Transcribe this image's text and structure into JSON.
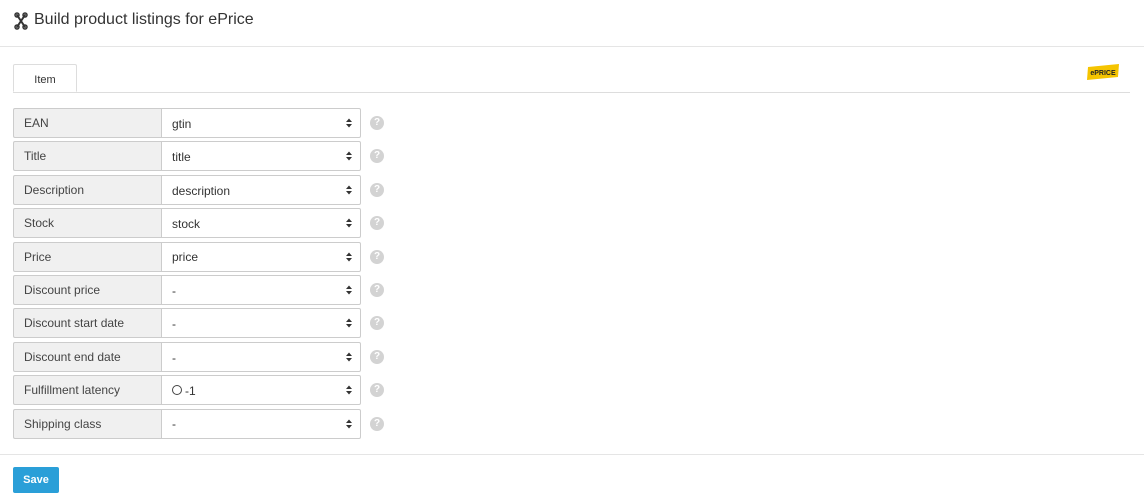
{
  "header": {
    "title": "Build product listings for ePrice",
    "icon": "wrench-cross-icon"
  },
  "tabs": [
    {
      "label": "Item",
      "active": true
    }
  ],
  "brand": {
    "name": "ePrice logo",
    "color": "#f5c400"
  },
  "fields": [
    {
      "label": "EAN",
      "value": "gtin",
      "radio": false
    },
    {
      "label": "Title",
      "value": "title",
      "radio": false
    },
    {
      "label": "Description",
      "value": "description",
      "radio": false
    },
    {
      "label": "Stock",
      "value": "stock",
      "radio": false
    },
    {
      "label": "Price",
      "value": "price",
      "radio": false
    },
    {
      "label": "Discount price",
      "value": "-",
      "radio": false
    },
    {
      "label": "Discount start date",
      "value": "-",
      "radio": false
    },
    {
      "label": "Discount end date",
      "value": "-",
      "radio": false
    },
    {
      "label": "Fulfillment latency",
      "value": "-1",
      "radio": true
    },
    {
      "label": "Shipping class",
      "value": "-",
      "radio": false
    }
  ],
  "help_glyph": "?",
  "footer": {
    "save_label": "Save"
  },
  "colors": {
    "accent": "#2a9fd8",
    "label_bg": "#f0f0f0",
    "border": "#cccccc",
    "help_icon": "#d3d3d3"
  }
}
